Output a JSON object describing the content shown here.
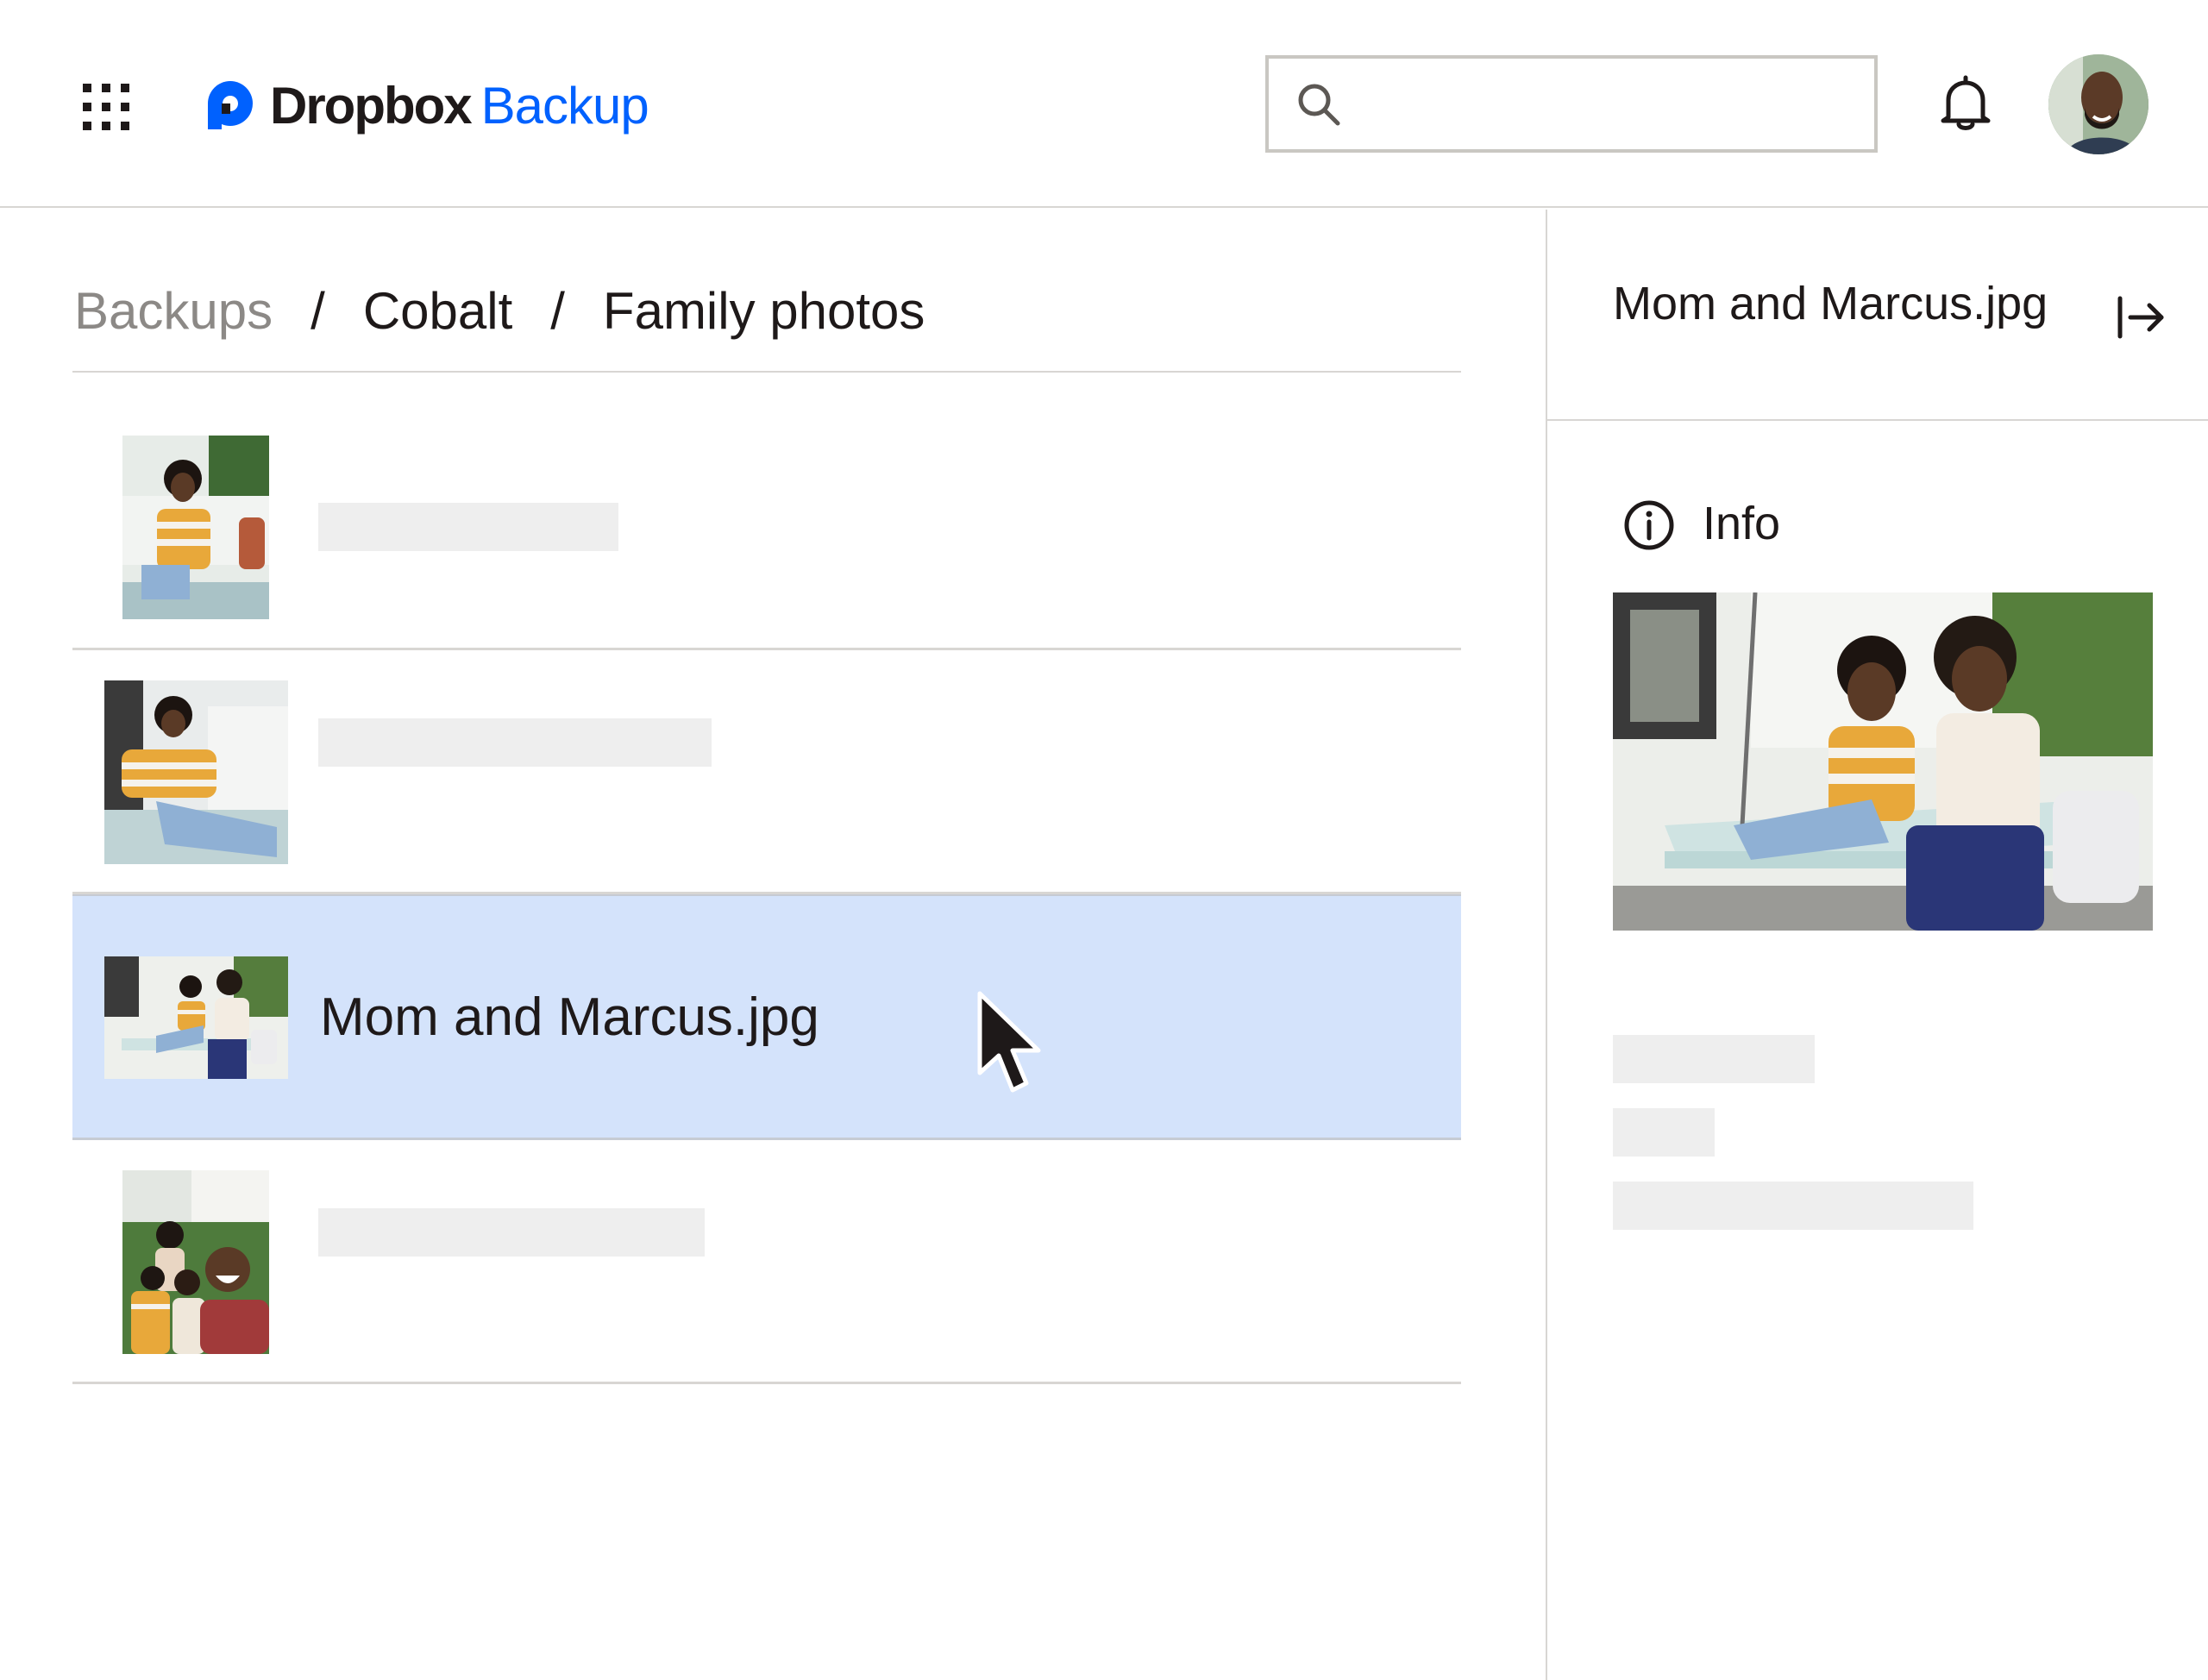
{
  "header": {
    "brand_name": "Dropbox",
    "product_name": "Backup",
    "search": {
      "value": "",
      "placeholder": ""
    },
    "brand_color": "#0061fe",
    "icons": [
      "app-grid-icon",
      "dropbox-logo-icon",
      "search-icon",
      "bell-icon",
      "avatar"
    ]
  },
  "breadcrumb": {
    "items": [
      "Backups",
      "Cobalt",
      "Family photos"
    ],
    "separator": "/"
  },
  "files": [
    {
      "name": "",
      "selected": false
    },
    {
      "name": "",
      "selected": false
    },
    {
      "name": "Mom and Marcus.jpg",
      "selected": true
    },
    {
      "name": "",
      "selected": false
    }
  ],
  "selection_color": "#d4e3fb",
  "panel": {
    "title": "Mom and Marcus.jpg",
    "section_label": "Info",
    "icons": [
      "collapse-panel-icon",
      "info-icon"
    ]
  }
}
